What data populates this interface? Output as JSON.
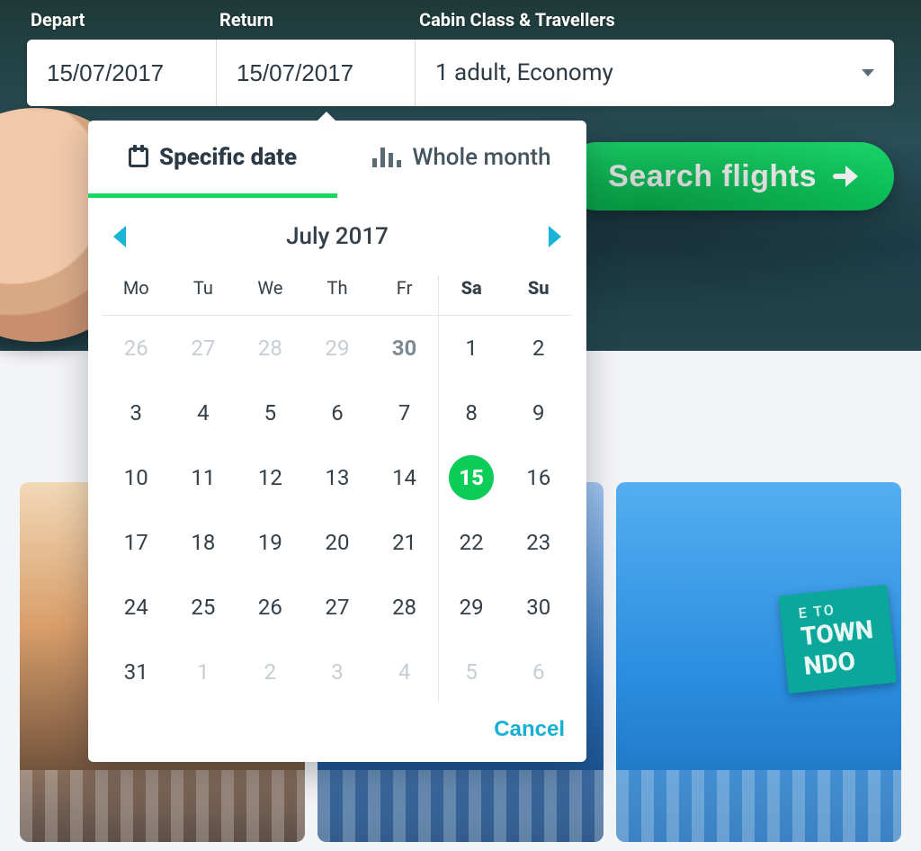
{
  "search": {
    "depart_label": "Depart",
    "return_label": "Return",
    "cabin_label": "Cabin Class & Travellers",
    "depart_value": "15/07/2017",
    "return_value": "15/07/2017",
    "cabin_value": "1 adult, Economy",
    "button_label": "Search flights"
  },
  "datepicker": {
    "tabs": {
      "specific": "Specific date",
      "whole": "Whole month"
    },
    "active_tab": "specific",
    "month_label": "July 2017",
    "dow": [
      "Mo",
      "Tu",
      "We",
      "Th",
      "Fr",
      "Sa",
      "Su"
    ],
    "weekend_index_start": 5,
    "selected_day": 15,
    "cancel_label": "Cancel",
    "cells": [
      {
        "n": 26,
        "state": "faded"
      },
      {
        "n": 27,
        "state": "faded"
      },
      {
        "n": 28,
        "state": "faded"
      },
      {
        "n": 29,
        "state": "faded"
      },
      {
        "n": 30,
        "state": "dim"
      },
      {
        "n": 1,
        "state": ""
      },
      {
        "n": 2,
        "state": ""
      },
      {
        "n": 3,
        "state": ""
      },
      {
        "n": 4,
        "state": ""
      },
      {
        "n": 5,
        "state": ""
      },
      {
        "n": 6,
        "state": ""
      },
      {
        "n": 7,
        "state": ""
      },
      {
        "n": 8,
        "state": ""
      },
      {
        "n": 9,
        "state": ""
      },
      {
        "n": 10,
        "state": ""
      },
      {
        "n": 11,
        "state": ""
      },
      {
        "n": 12,
        "state": ""
      },
      {
        "n": 13,
        "state": ""
      },
      {
        "n": 14,
        "state": ""
      },
      {
        "n": 15,
        "state": "selected"
      },
      {
        "n": 16,
        "state": ""
      },
      {
        "n": 17,
        "state": ""
      },
      {
        "n": 18,
        "state": ""
      },
      {
        "n": 19,
        "state": ""
      },
      {
        "n": 20,
        "state": ""
      },
      {
        "n": 21,
        "state": ""
      },
      {
        "n": 22,
        "state": ""
      },
      {
        "n": 23,
        "state": ""
      },
      {
        "n": 24,
        "state": ""
      },
      {
        "n": 25,
        "state": ""
      },
      {
        "n": 26,
        "state": ""
      },
      {
        "n": 27,
        "state": ""
      },
      {
        "n": 28,
        "state": ""
      },
      {
        "n": 29,
        "state": ""
      },
      {
        "n": 30,
        "state": ""
      },
      {
        "n": 31,
        "state": ""
      },
      {
        "n": 1,
        "state": "faded"
      },
      {
        "n": 2,
        "state": "faded"
      },
      {
        "n": 3,
        "state": "faded"
      },
      {
        "n": 4,
        "state": "faded"
      },
      {
        "n": 5,
        "state": "faded"
      },
      {
        "n": 6,
        "state": "faded"
      }
    ]
  },
  "promo": {
    "line1": "TOWN",
    "line2": "NDO",
    "eyebrow": "E TO"
  }
}
